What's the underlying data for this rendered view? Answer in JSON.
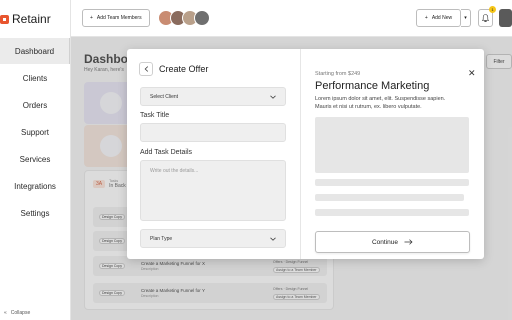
{
  "app": {
    "name": "Retainr",
    "brand_color": "#e8552f"
  },
  "sidebar": {
    "items": [
      {
        "label": "Dashboard",
        "active": true
      },
      {
        "label": "Clients",
        "active": false
      },
      {
        "label": "Orders",
        "active": false
      },
      {
        "label": "Support",
        "active": false
      },
      {
        "label": "Services",
        "active": false
      },
      {
        "label": "Integrations",
        "active": false
      },
      {
        "label": "Settings",
        "active": false
      }
    ],
    "collapse_label": "Collapse"
  },
  "topbar": {
    "add_team_label": "Add Team Members",
    "add_new_label": "Add New",
    "notification_count": "1"
  },
  "page": {
    "title": "Dashboard",
    "subtitle": "Hey Karan, here's",
    "filter_label": "Filter",
    "board": {
      "badge": "3A",
      "label_top": "Tasks",
      "label": "In Back"
    },
    "tasks": [
      {
        "tag": "Design Copy",
        "title": "",
        "desc": "",
        "offer": "",
        "assign": ""
      },
      {
        "tag": "Design Copy",
        "title": "",
        "desc": "",
        "offer": "",
        "assign": ""
      },
      {
        "tag": "Design Copy",
        "title": "Create a Marketing Funnel for X",
        "desc": "Description",
        "offer": "Offers · Design Funnel",
        "assign": "Assign to a Team Member"
      },
      {
        "tag": "Design Copy",
        "title": "Create a Marketing Funnel for Y",
        "desc": "Description",
        "offer": "Offers · Design Funnel",
        "assign": "Assign to a Team Member"
      }
    ]
  },
  "modal": {
    "title": "Create Offer",
    "select_client_placeholder": "Select Client",
    "task_title_label": "Task Title",
    "task_details_label": "Add Task Details",
    "task_details_placeholder": "Write out the details...",
    "plan_type_placeholder": "Plan Type",
    "offer": {
      "starting_from": "Starting from $249",
      "title": "Performance Marketing",
      "description": "Lorem ipsum dolor sit amet, elit. Suspendisse sapien. Mauris et nisi ut rutrum, ex. libero vulputate."
    },
    "continue_label": "Continue"
  }
}
